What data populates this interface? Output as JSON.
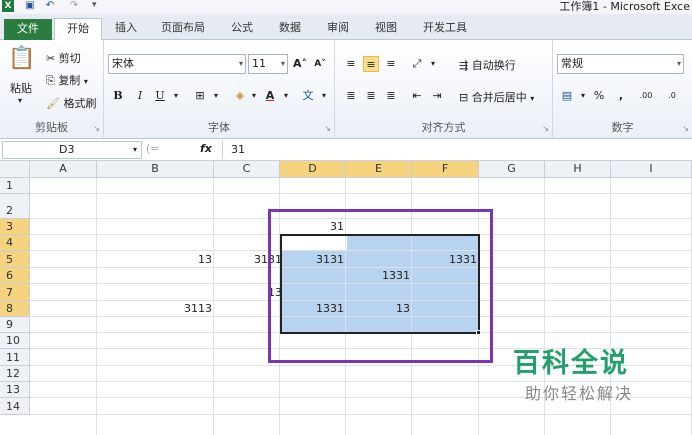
{
  "titlebar": {
    "logo": "X",
    "title": "工作簿1 - Microsoft Exce",
    "qa_menu": "▾"
  },
  "tabs": [
    "文件",
    "开始",
    "插入",
    "页面布局",
    "公式",
    "数据",
    "审阅",
    "视图",
    "开发工具"
  ],
  "ribbon": {
    "clipboard": {
      "label": "剪贴板",
      "paste": "粘贴",
      "cut": "剪切",
      "copy": "复制",
      "format_painter": "格式刷"
    },
    "font": {
      "label": "字体",
      "name": "宋体",
      "size": "11"
    },
    "alignment": {
      "label": "对齐方式",
      "wrap": "自动换行",
      "merge": "合并后居中"
    },
    "number": {
      "label": "数字",
      "format": "常规"
    }
  },
  "formula_bar": {
    "name_box": "D3",
    "fx": "fx",
    "value": "31"
  },
  "grid": {
    "columns": [
      "A",
      "B",
      "C",
      "D",
      "E",
      "F",
      "G",
      "H",
      "I"
    ],
    "rows": [
      "1",
      "2",
      "3",
      "4",
      "5",
      "6",
      "7",
      "8",
      "9",
      "10",
      "11",
      "12",
      "13",
      "14"
    ],
    "cells": {
      "D3": "31",
      "B5": "13",
      "C5": "3131",
      "D5": "3131",
      "F5": "1331",
      "E6": "1331",
      "C7": "13",
      "B8": "3113",
      "D8": "1331",
      "E8": "13"
    }
  },
  "watermark": {
    "title": "百科全说",
    "subtitle": "助你轻松解决"
  },
  "colors": {
    "accent_green": "#2a7d3e",
    "selection": "#b8d3ef",
    "annotation": "#7b35b6",
    "header_selected": "#f5d37f"
  }
}
